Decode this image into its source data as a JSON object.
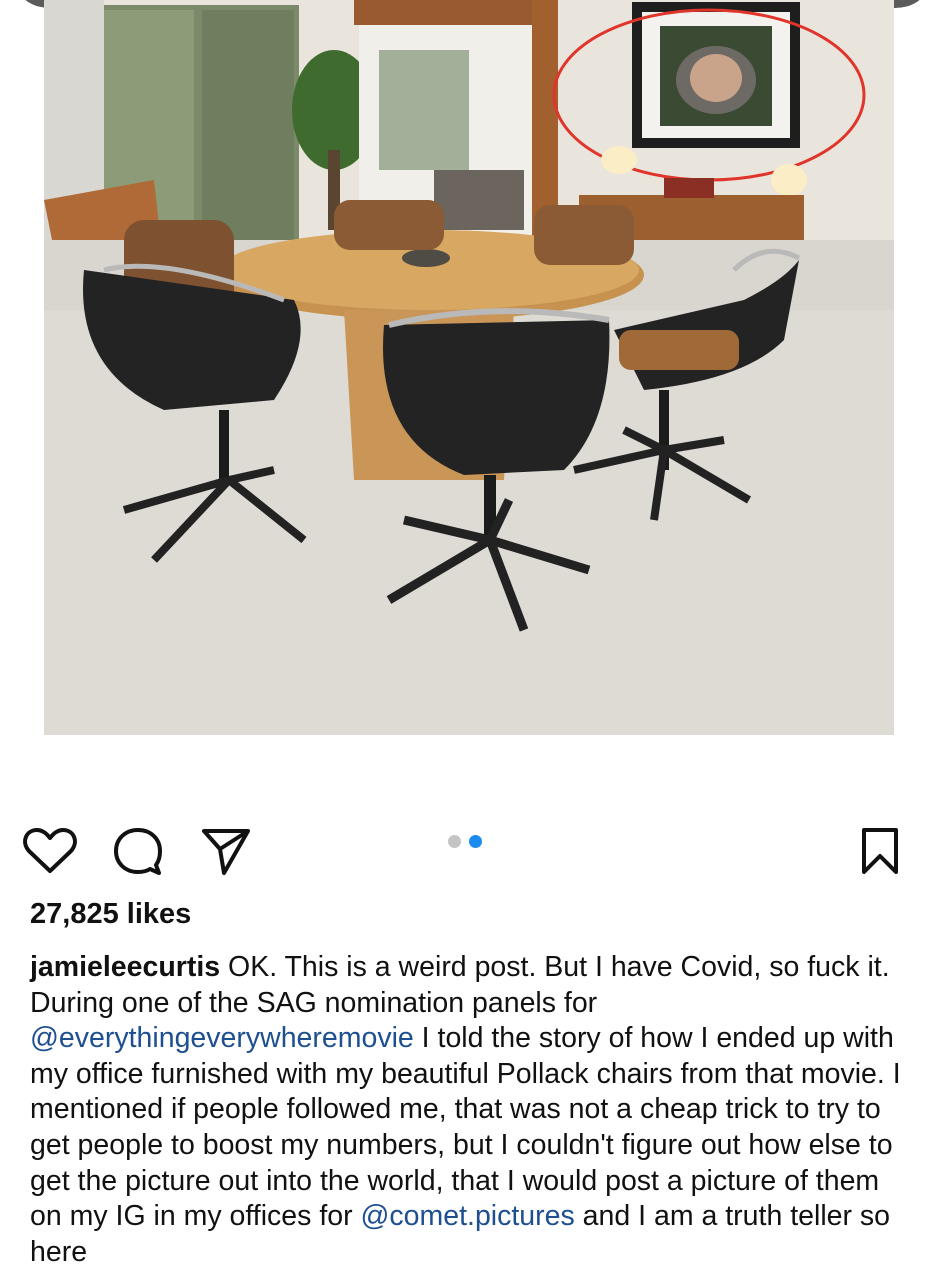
{
  "post": {
    "image_description_icon": "dining-room-photo",
    "carousel": {
      "count": 2,
      "active_index": 1
    },
    "actions": {
      "like_icon": "heart-icon",
      "comment_icon": "comment-icon",
      "share_icon": "paper-plane-icon",
      "save_icon": "bookmark-icon"
    },
    "likes_text": "27,825 likes",
    "caption": {
      "username": "jamieleecurtis",
      "text_1": " OK. This is a weird post. But I have Covid, so fuck it. During one of the SAG nomination panels for ",
      "mention_1": "@everythingeverywheremovie",
      "text_2": " I told the story of how I ended up with my office furnished with my beautiful Pollack chairs from that movie. I mentioned if people followed me, that was not a cheap trick to try to get people to boost my numbers, but I couldn't figure out how else to get the picture out into the world, that I would post a picture of them on my IG in my offices for ",
      "mention_2": "@comet.pictures",
      "text_3": " and I am a truth teller so here"
    }
  },
  "colors": {
    "accent_blue": "#1c8bf0",
    "mention_blue": "#1d4f91",
    "annotation_red": "#e0352b"
  }
}
